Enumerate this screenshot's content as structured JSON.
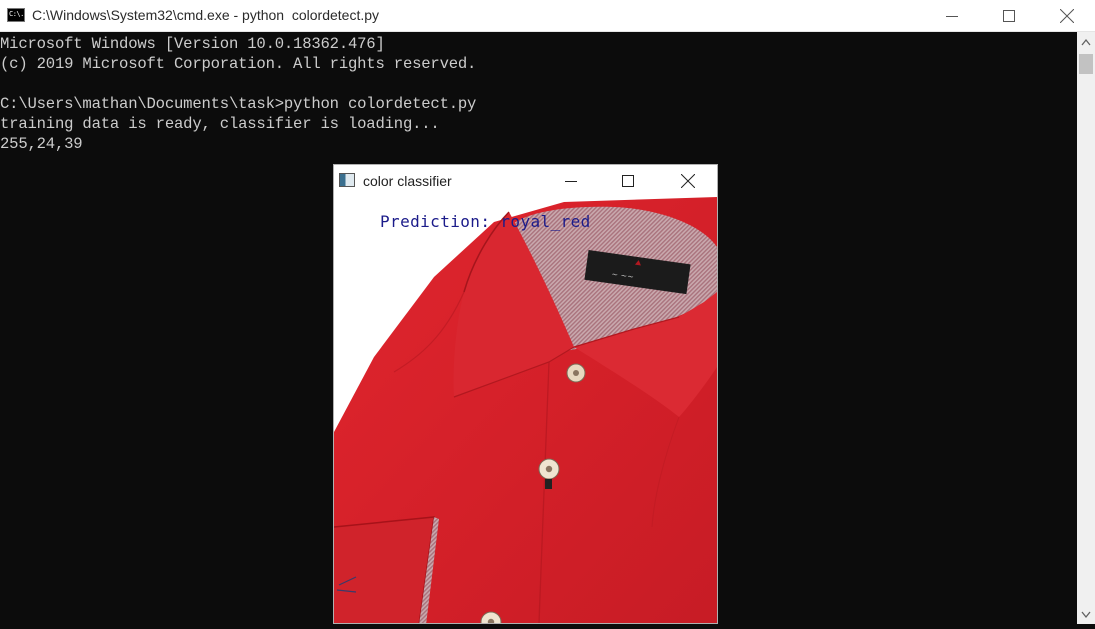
{
  "cmd_window": {
    "title": "C:\\Windows\\System32\\cmd.exe - python  colordetect.py",
    "icon": "cmd-icon",
    "icon_text": "C:\\."
  },
  "console": {
    "lines": [
      "Microsoft Windows [Version 10.0.18362.476]",
      "(c) 2019 Microsoft Corporation. All rights reserved.",
      "",
      "C:\\Users\\mathan\\Documents\\task>python colordetect.py",
      "training data is ready, classifier is loading...",
      "255,24,39"
    ]
  },
  "classifier_window": {
    "title": "color classifier",
    "prediction_text": "Prediction: royal_red"
  },
  "colors": {
    "console_bg": "#0c0c0c",
    "console_text": "#cccccc",
    "shirt_red": "#d7232b",
    "prediction_text": "#1b1b8a"
  }
}
